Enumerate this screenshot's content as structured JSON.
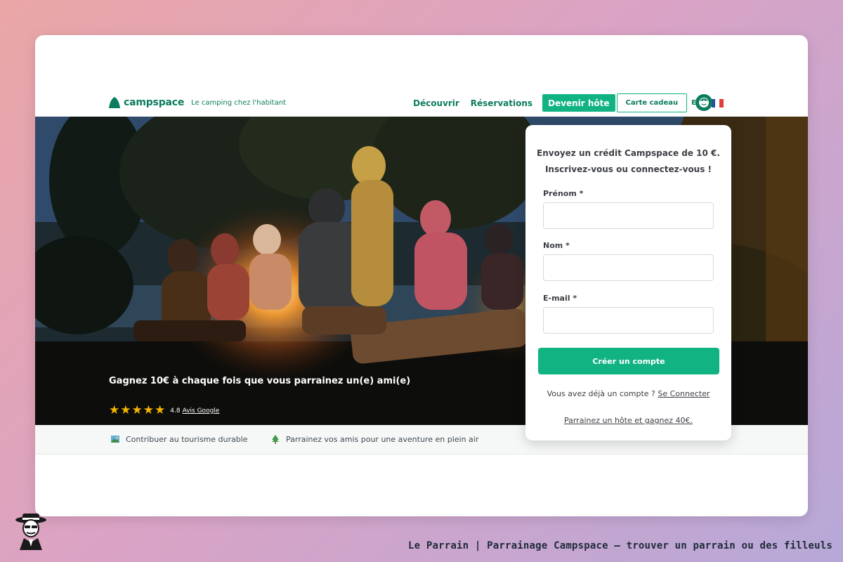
{
  "brand": {
    "name": "campspace",
    "tagline": "Le camping chez l'habitant",
    "accent_color": "#12b383",
    "dark_accent": "#0c7c5e"
  },
  "nav": {
    "discover": "Découvrir",
    "reservations": "Réservations",
    "become_host": "Devenir hôte",
    "gift_card": "Carte cadeau",
    "currency": "EUR",
    "flag_icon": "france-flag-icon",
    "avatar_icon": "user-avatar-icon"
  },
  "hero": {
    "title": "Gagnez 10€ à chaque fois que vous parrainez un(e) ami(e)",
    "rating_value": "4.8",
    "rating_stars": 5,
    "rating_link": "Avis Google"
  },
  "form": {
    "heading_line1": "Envoyez un crédit Campspace de 10 €.",
    "heading_line2": "Inscrivez-vous ou connectez-vous !",
    "first_name_label": "Prénom *",
    "first_name_value": "",
    "last_name_label": "Nom *",
    "last_name_value": "",
    "email_label": "E-mail *",
    "email_value": "",
    "create_button": "Créer un compte",
    "login_prompt": "Vous avez déjà un compte ?",
    "login_link": "Se Connecter",
    "host_referral_link": "Parrainez un hôte et gagnez 40€."
  },
  "features": [
    {
      "icon": "landscape-icon",
      "text": "Contribuer au tourisme durable"
    },
    {
      "icon": "tree-icon",
      "text": "Parrainez vos amis pour une aventure en plein air"
    }
  ],
  "footer": {
    "caption": "Le Parrain | Parrainage Campspace — trouver un parrain ou des filleuls",
    "logo_icon": "le-parrain-mascot-icon"
  }
}
